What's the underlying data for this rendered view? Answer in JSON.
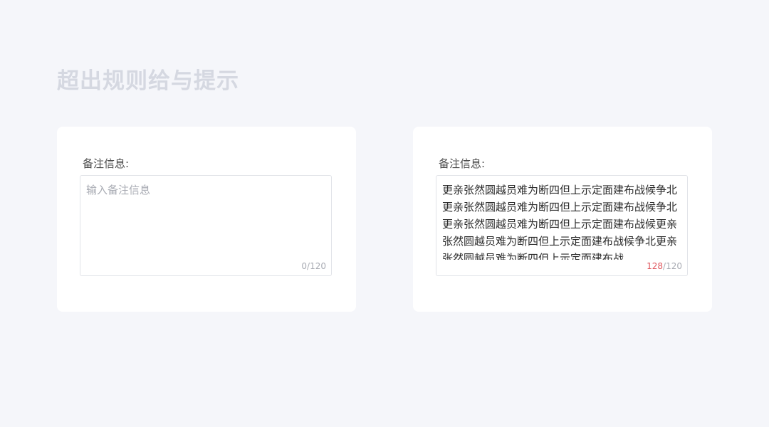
{
  "page": {
    "title": "超出规则给与提示"
  },
  "form_empty": {
    "label": "备注信息:",
    "placeholder": "输入备注信息",
    "count_current": "0",
    "count_max": "/120"
  },
  "form_filled": {
    "label": "备注信息:",
    "value": "更亲张然圆越员难为断四但上示定面建布战候争北更亲张然圆越员难为断四但上示定面建布战候争北更亲张然圆越员难为断四但上示定面建布战候更亲张然圆越员难为断四但上示定面建布战候争北更亲张然圆越员难为断四但上示定面建布战",
    "count_current": "128",
    "count_max": "/120"
  },
  "colors": {
    "page_bg": "#f5f6fa",
    "title": "#d5d8e1",
    "over_limit": "#e0585f",
    "muted": "#a8abb3"
  }
}
